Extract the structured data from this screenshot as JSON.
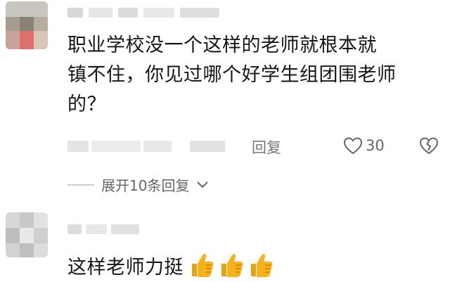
{
  "comments": [
    {
      "text_lines": [
        "职业学校没一个这样的老师就根本就",
        "镇不住，你见过哪个好学生组团围老师",
        "的？"
      ],
      "reply_label": "回复",
      "like_count": "30",
      "expand_label": "展开10条回复"
    },
    {
      "text": "这样老师力挺"
    }
  ],
  "icons": {
    "like": "heart-outline-icon",
    "dislike": "broken-heart-icon",
    "expand": "chevron-down-icon",
    "emoji": "thumbs-up-emoji"
  },
  "colors": {
    "text": "#161616",
    "secondary": "#777777",
    "divider": "#cfcfcf",
    "thumb": "#f7b21b"
  }
}
